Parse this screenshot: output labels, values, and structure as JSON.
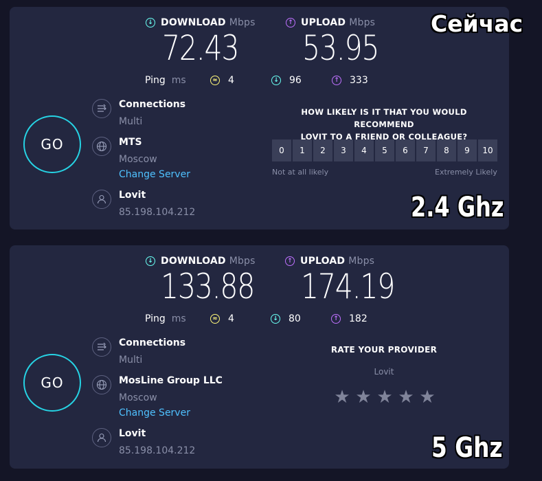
{
  "panels": [
    {
      "download": {
        "label": "DOWNLOAD",
        "unit": "Mbps",
        "value": "72.43"
      },
      "upload": {
        "label": "UPLOAD",
        "unit": "Mbps",
        "value": "53.95"
      },
      "ping": {
        "label": "Ping",
        "unit": "ms",
        "jitter": "4",
        "download": "96",
        "upload": "333"
      },
      "go_label": "GO",
      "connections": {
        "title": "Connections",
        "value": "Multi"
      },
      "server": {
        "name": "MTS",
        "location": "Moscow",
        "change_label": "Change Server"
      },
      "provider": {
        "name": "Lovit",
        "ip": "85.198.104.212"
      },
      "survey": {
        "question_line1": "HOW LIKELY IS IT THAT YOU WOULD RECOMMEND",
        "question_line2": "LOVIT TO A FRIEND OR COLLEAGUE?",
        "scale": [
          "0",
          "1",
          "2",
          "3",
          "4",
          "5",
          "6",
          "7",
          "8",
          "9",
          "10"
        ],
        "low_label": "Not at all likely",
        "high_label": "Extremely Likely"
      },
      "overlay": "2.4 Ghz"
    },
    {
      "download": {
        "label": "DOWNLOAD",
        "unit": "Mbps",
        "value": "133.88"
      },
      "upload": {
        "label": "UPLOAD",
        "unit": "Mbps",
        "value": "174.19"
      },
      "ping": {
        "label": "Ping",
        "unit": "ms",
        "jitter": "4",
        "download": "80",
        "upload": "182"
      },
      "go_label": "GO",
      "connections": {
        "title": "Connections",
        "value": "Multi"
      },
      "server": {
        "name": "MosLine Group LLC",
        "location": "Moscow",
        "change_label": "Change Server"
      },
      "provider": {
        "name": "Lovit",
        "ip": "85.198.104.212"
      },
      "rating": {
        "title": "RATE YOUR PROVIDER",
        "provider": "Lovit",
        "stars": 5
      },
      "overlay": "5 Ghz"
    }
  ],
  "top_overlay": "Сейчас",
  "icons": {
    "download": "download-arrow-icon",
    "upload": "upload-arrow-icon",
    "jitter": "jitter-icon",
    "connections": "connections-icon",
    "server": "globe-icon",
    "provider": "user-icon",
    "star": "star-icon"
  },
  "colors": {
    "download": "#6afff3",
    "upload": "#bf71ff",
    "jitter": "#fff77a",
    "go_ring": "#26d3e4",
    "link": "#4fc1ff"
  }
}
